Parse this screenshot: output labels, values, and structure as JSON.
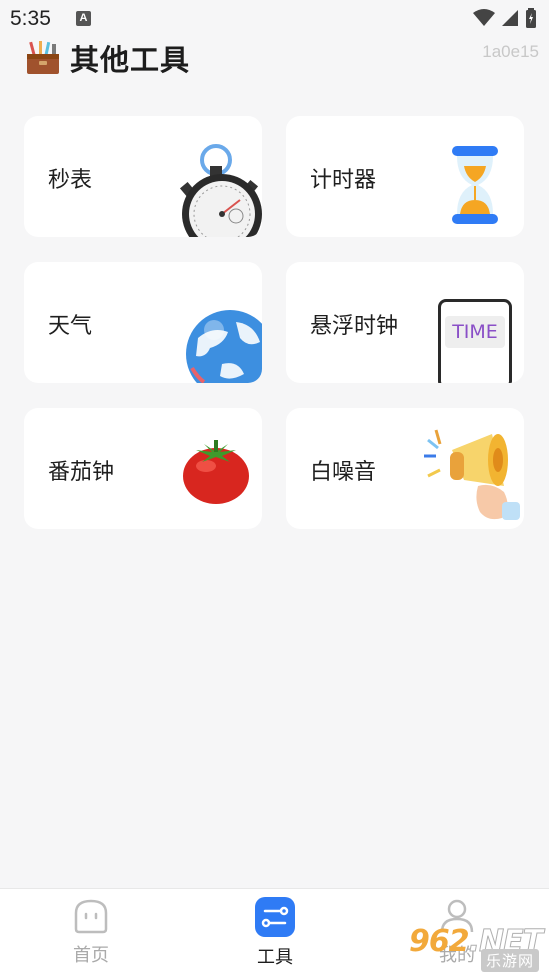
{
  "status_bar": {
    "time": "5:35",
    "notification_icon": "A"
  },
  "header": {
    "title": "其他工具",
    "icon": "toolbox-icon",
    "build_id": "1a0e15"
  },
  "tools": [
    {
      "label": "秒表",
      "icon": "stopwatch-icon"
    },
    {
      "label": "计时器",
      "icon": "hourglass-icon"
    },
    {
      "label": "天气",
      "icon": "globe-icon"
    },
    {
      "label": "悬浮时钟",
      "icon": "phone-time-icon",
      "art_text": "TIME"
    },
    {
      "label": "番茄钟",
      "icon": "tomato-icon"
    },
    {
      "label": "白噪音",
      "icon": "megaphone-icon"
    }
  ],
  "bottom_nav": [
    {
      "label": "首页",
      "icon": "home-icon",
      "active": false
    },
    {
      "label": "工具",
      "icon": "tools-icon",
      "active": true
    },
    {
      "label": "我的",
      "icon": "profile-icon",
      "active": false
    }
  ],
  "watermark": {
    "brand": "962",
    "brand_suffix": ".NET",
    "sub": "乐游网"
  },
  "colors": {
    "background": "#f6f6f7",
    "card": "#ffffff",
    "accent": "#2f7bf5",
    "inactive": "#aaaaaa"
  }
}
